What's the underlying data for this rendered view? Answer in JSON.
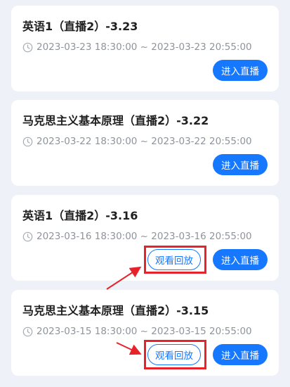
{
  "accent_color": "#1677ff",
  "highlight_color": "#e8222b",
  "icons": {
    "time": "clock-icon"
  },
  "courses": [
    {
      "title": "英语1（直播2）-3.23",
      "time": "2023-03-23 18:30:00 ~ 2023-03-23 20:55:00",
      "live_label": "进入直播",
      "replay_label": null
    },
    {
      "title": "马克思主义基本原理（直播2）-3.22",
      "time": "2023-03-22 18:30:00 ~ 2023-03-22 20:55:00",
      "live_label": "进入直播",
      "replay_label": null
    },
    {
      "title": "英语1（直播2）-3.16",
      "time": "2023-03-16 18:30:00 ~ 2023-03-16 20:55:00",
      "live_label": "进入直播",
      "replay_label": "观看回放"
    },
    {
      "title": "马克思主义基本原理（直播2）-3.15",
      "time": "2023-03-15 18:30:00 ~ 2023-03-15 20:55:00",
      "live_label": "进入直播",
      "replay_label": "观看回放"
    }
  ]
}
